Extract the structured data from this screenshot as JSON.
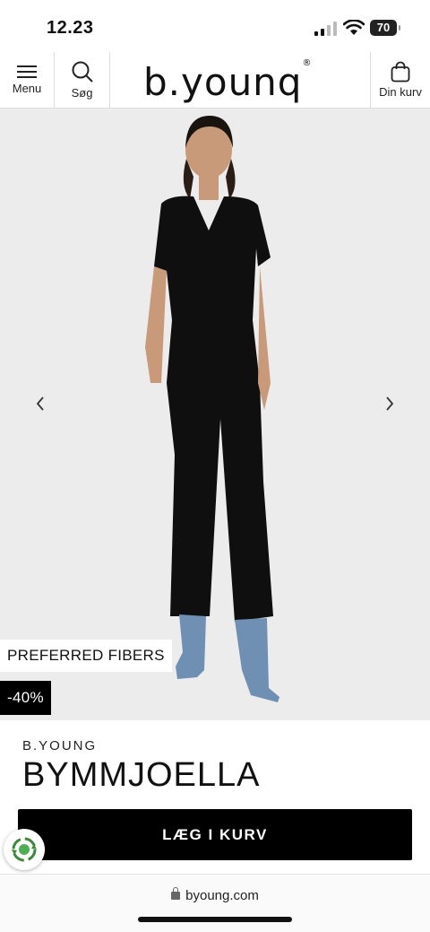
{
  "status_bar": {
    "time": "12.23",
    "battery": "70"
  },
  "nav": {
    "menu_label": "Menu",
    "search_label": "Søg",
    "logo_text": "b.younq",
    "cart_label": "Din kurv"
  },
  "product": {
    "tags": {
      "fibers": "PREFERRED FIBERS",
      "discount": "-40%"
    },
    "brand": "B.YOUNG",
    "name": "BYMMJOELLA",
    "add_to_cart": "LÆG I KURV"
  },
  "browser": {
    "url": "byoung.com"
  },
  "colors": {
    "accent": "#000000",
    "hero_bg": "#ececec",
    "badge_green": "#3a8a3a"
  },
  "icons": [
    "signal-icon",
    "wifi-icon",
    "battery-icon",
    "hamburger-icon",
    "search-icon",
    "bag-icon",
    "chevron-left-icon",
    "chevron-right-icon",
    "eco-badge-icon",
    "lock-icon"
  ]
}
